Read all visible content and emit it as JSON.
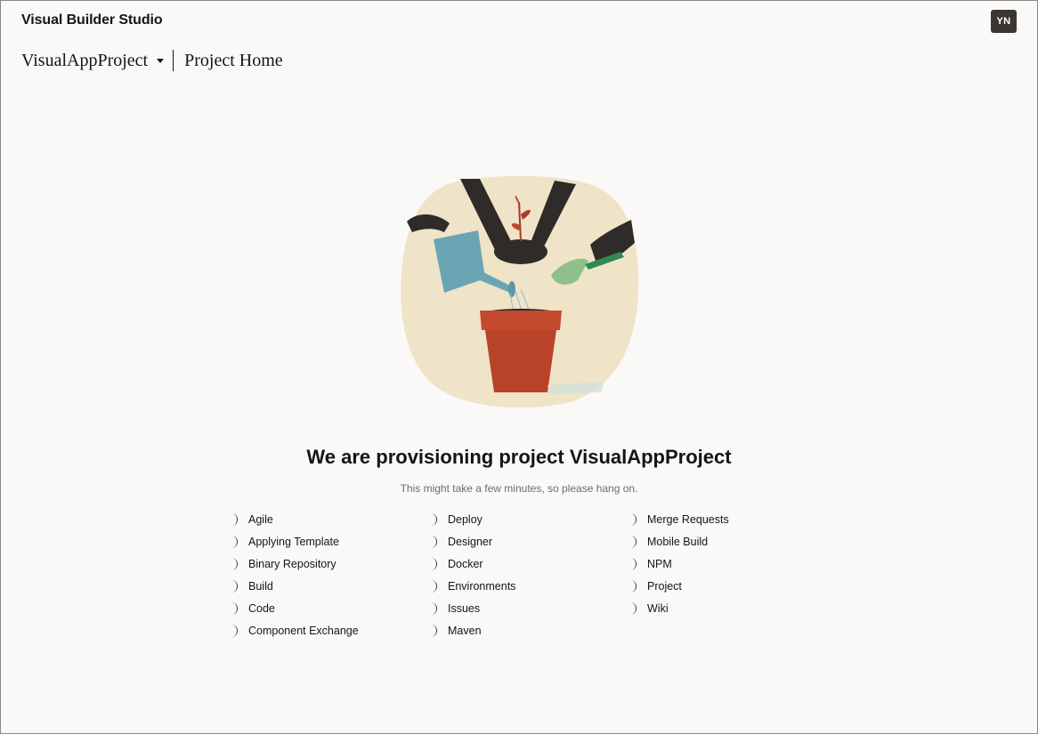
{
  "header": {
    "app_title": "Visual Builder Studio",
    "avatar_initials": "YN"
  },
  "project_bar": {
    "project_name": "VisualAppProject",
    "page_name": "Project Home"
  },
  "main": {
    "headline": "We are provisioning project VisualAppProject",
    "subtext": "This might take a few minutes, so please hang on.",
    "service_columns": [
      [
        "Agile",
        "Applying Template",
        "Binary Repository",
        "Build",
        "Code",
        "Component Exchange"
      ],
      [
        "Deploy",
        "Designer",
        "Docker",
        "Environments",
        "Issues",
        "Maven"
      ],
      [
        "Merge Requests",
        "Mobile Build",
        "NPM",
        "Project",
        "Wiki"
      ]
    ]
  },
  "colors": {
    "background": "#fbf9f8",
    "text": "#161513",
    "muted": "#6f6c69",
    "avatar_bg": "#3a3632"
  }
}
